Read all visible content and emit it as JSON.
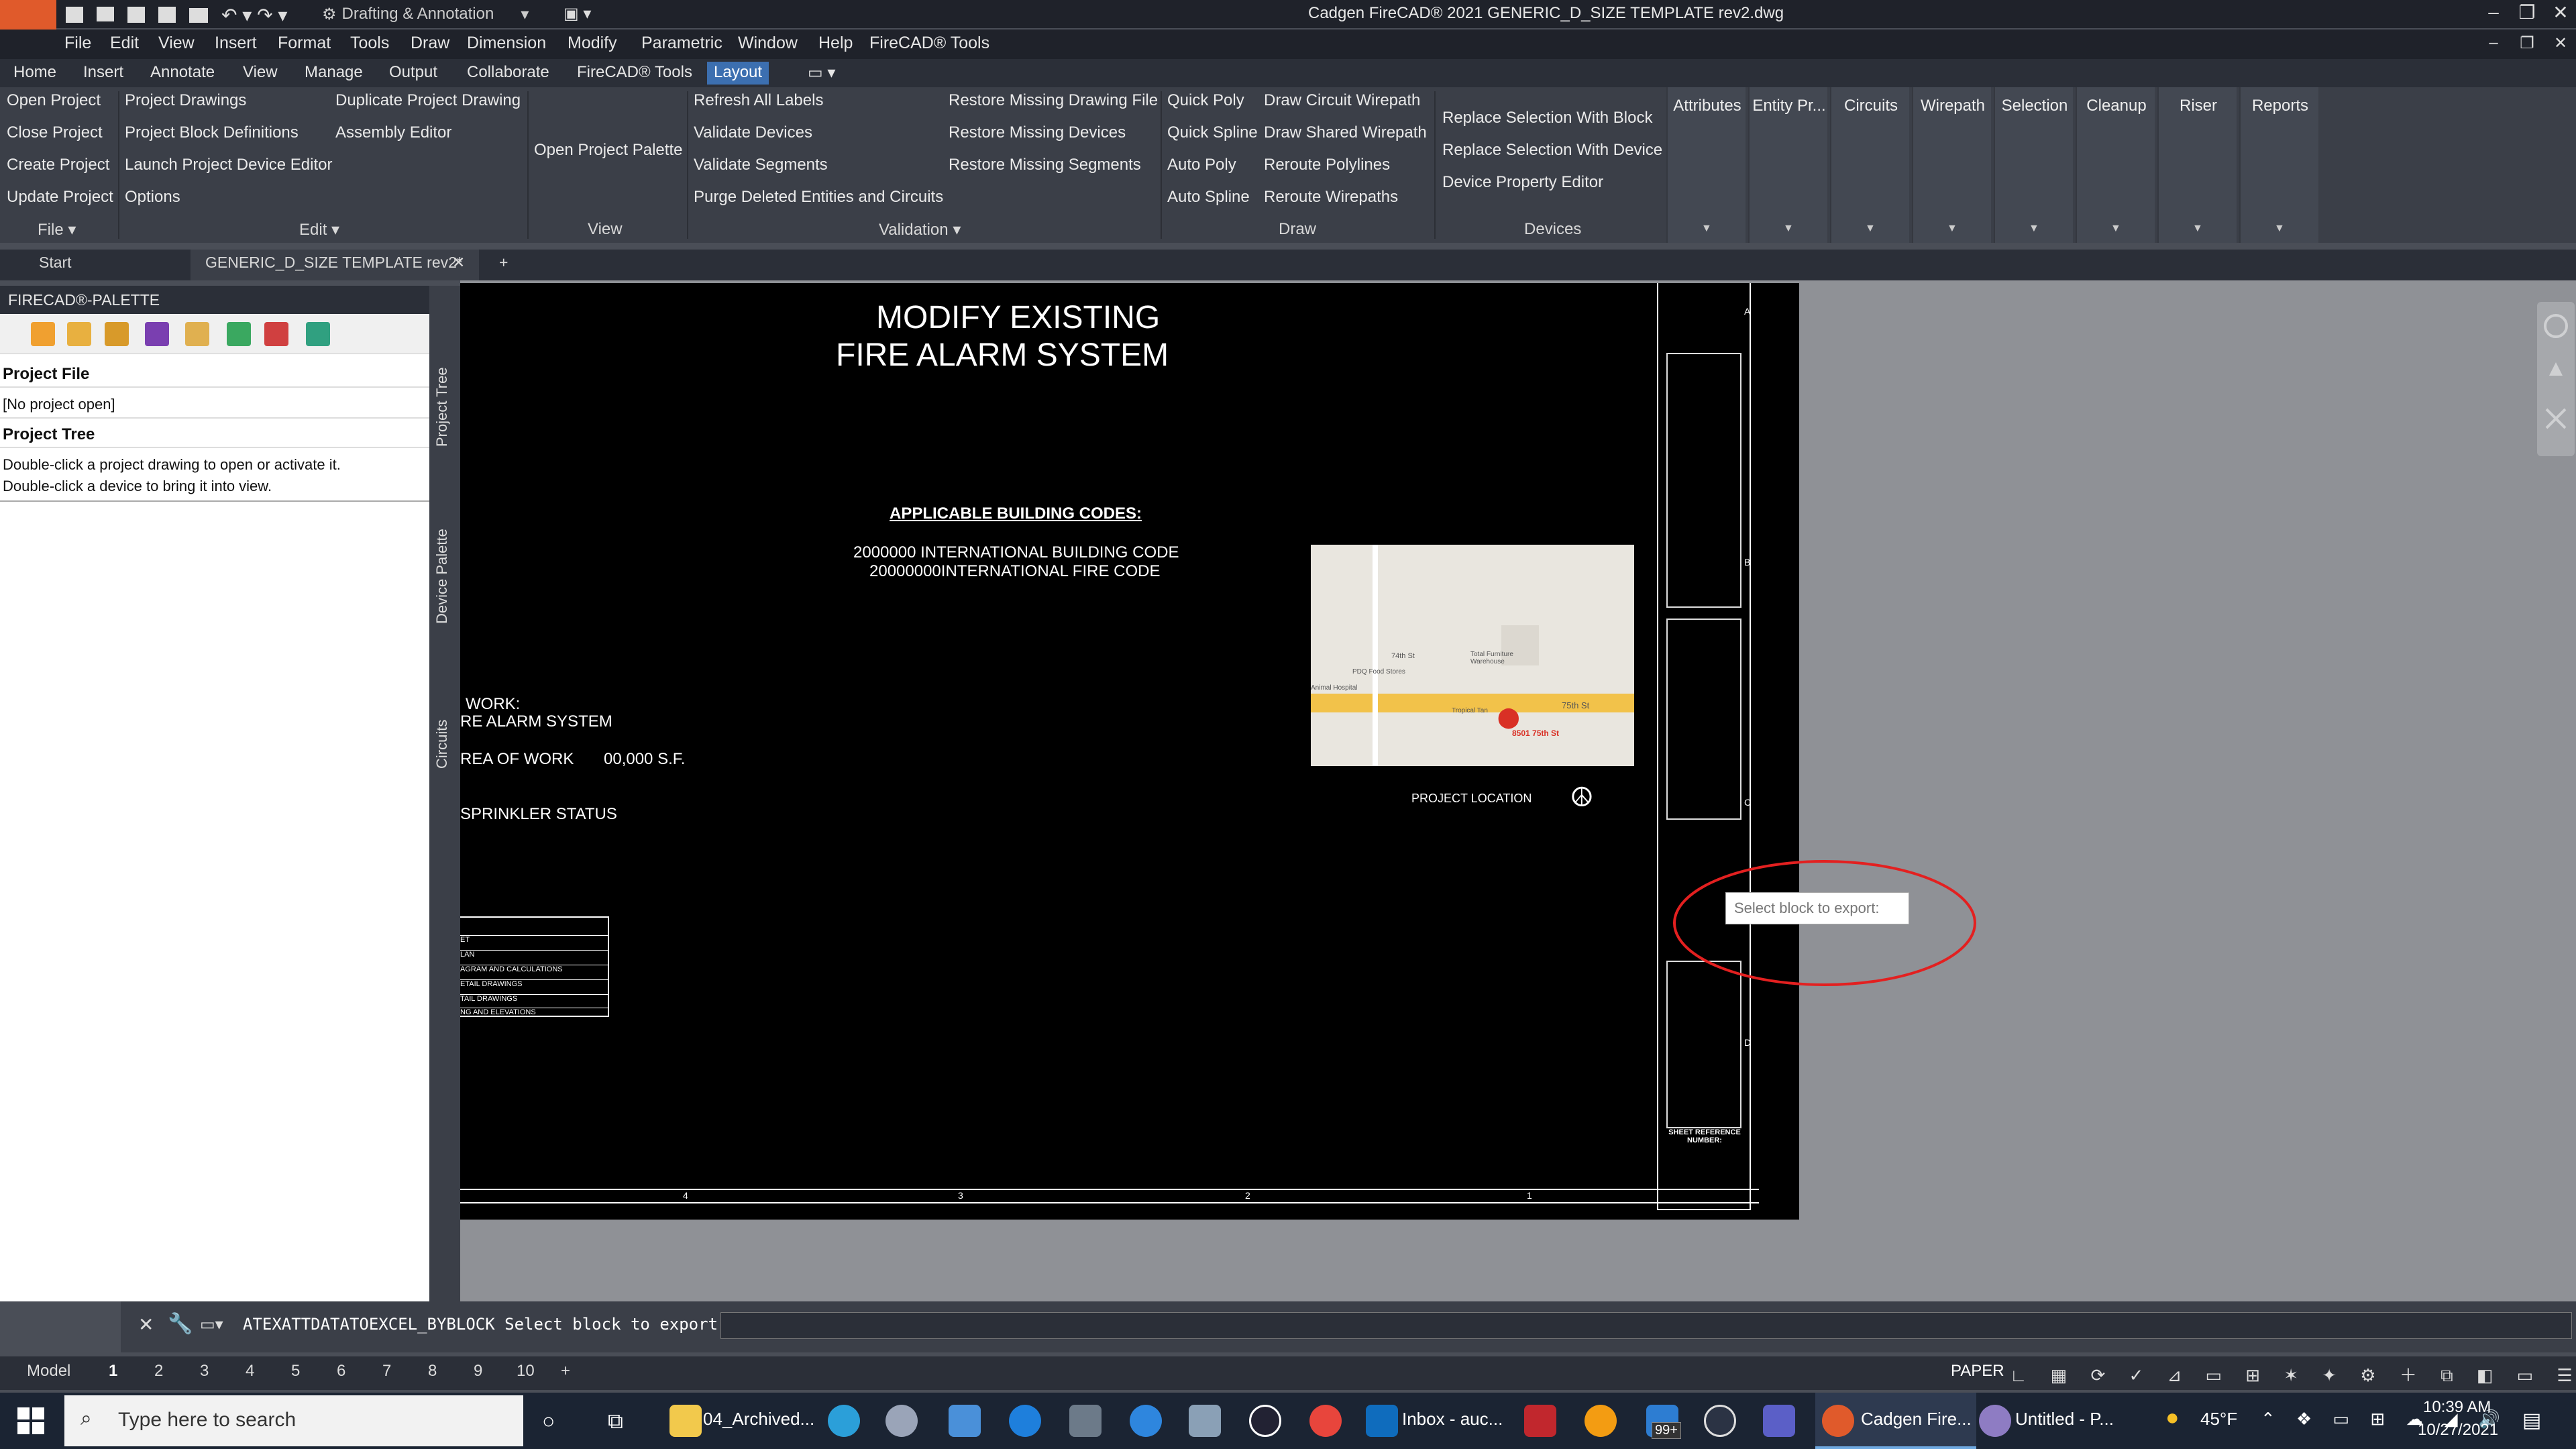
{
  "window": {
    "title": "Cadgen FireCAD® 2021    GENERIC_D_SIZE TEMPLATE rev2.dwg",
    "workspace": "Drafting & Annotation"
  },
  "menu": [
    "File",
    "Edit",
    "View",
    "Insert",
    "Format",
    "Tools",
    "Draw",
    "Dimension",
    "Modify",
    "Parametric",
    "Window",
    "Help",
    "FireCAD® Tools"
  ],
  "ribbon_tabs": [
    "Home",
    "Insert",
    "Annotate",
    "View",
    "Manage",
    "Output",
    "Collaborate",
    "FireCAD® Tools",
    "Layout"
  ],
  "ribbon": {
    "file": {
      "items": [
        "Open Project",
        "Close Project",
        "Create Project",
        "Update Project"
      ],
      "label": "File"
    },
    "edit": {
      "col1": [
        "Project Drawings",
        "Project Block Definitions",
        "Launch Project Device Editor",
        "Options"
      ],
      "col2": [
        "Duplicate Project Drawing",
        "Assembly Editor"
      ],
      "label": "Edit"
    },
    "view": {
      "items": [
        "Open Project Palette"
      ],
      "label": "View"
    },
    "validation": {
      "col1": [
        "Refresh All Labels",
        "Validate Devices",
        "Validate Segments",
        "Purge Deleted Entities and Circuits"
      ],
      "col2": [
        "Restore Missing Drawing File",
        "Restore Missing Devices",
        "Restore Missing Segments"
      ],
      "label": "Validation"
    },
    "draw": {
      "col1": [
        "Quick Poly",
        "Quick Spline",
        "Auto Poly",
        "Auto Spline"
      ],
      "col2": [
        "Draw Circuit Wirepath",
        "Draw Shared  Wirepath",
        "Reroute Polylines",
        "Reroute Wirepaths"
      ],
      "label": "Draw"
    },
    "devices": {
      "items": [
        "Replace Selection With Block",
        "Replace Selection With Device",
        "Device Property Editor"
      ],
      "label": "Devices"
    },
    "big_buttons": [
      "Attributes",
      "Entity Pr...",
      "Circuits",
      "Wirepath",
      "Selection",
      "Cleanup",
      "Riser",
      "Reports"
    ]
  },
  "doc_tabs": [
    "Start",
    "GENERIC_D_SIZE TEMPLATE rev2*"
  ],
  "palette": {
    "title": "FIRECAD®-PALETTE",
    "project_file_heading": "Project File",
    "project_file_value": "[No project open]",
    "project_tree_heading": "Project Tree",
    "hint1": "Double-click a project drawing to open or activate it.",
    "hint2": "Double-click a device to bring it into view.",
    "side_tabs": [
      "Project Tree",
      "Device Palette",
      "Circuits"
    ]
  },
  "drawing": {
    "title1": "MODIFY EXISTING",
    "title2": "FIRE ALARM SYSTEM",
    "codes_heading": "APPLICABLE BUILDING CODES:",
    "code1": "2000000 INTERNATIONAL BUILDING CODE",
    "code2": "20000000INTERNATIONAL FIRE CODE",
    "work1": "WORK:",
    "work2": "RE ALARM SYSTEM",
    "area": "REA OF WORK",
    "area_value": "00,000 S.F.",
    "sprinkler": "SPRINKLER STATUS",
    "index": [
      "ET",
      "LAN",
      "AGRAM AND CALCULATIONS",
      "ETAIL DRAWINGS",
      "TAIL DRAWINGS",
      "NG AND ELEVATIONS"
    ],
    "project_location": "PROJECT LOCATION",
    "map": {
      "st74": "74th St",
      "st75": "75th St",
      "pdq": "PDQ Food Stores",
      "furniture": "Total Furniture Warehouse",
      "hospital": "Animal Hospital",
      "tan": "Tropical Tan",
      "pin": "8501 75th St"
    },
    "sheet_ref": "SHEET REFERENCE NUMBER:",
    "grid_numbers": [
      "4",
      "3",
      "2",
      "1"
    ],
    "grid_letters": [
      "A",
      "B",
      "C",
      "D"
    ]
  },
  "tooltip": "Select block to export:",
  "command": {
    "text": "ATEXATTDATATOEXCEL_BYBLOCK Select block to export:",
    "value": ""
  },
  "layout_tabs": {
    "model": "Model",
    "pages": [
      "1",
      "2",
      "3",
      "4",
      "5",
      "6",
      "7",
      "8",
      "9",
      "10"
    ],
    "paper": "PAPER"
  },
  "taskbar": {
    "search_placeholder": "Type here to search",
    "apps": [
      "04_Archived...",
      "Inbox - auc...",
      "Cadgen Fire...",
      "Untitled - P..."
    ],
    "badge": "99+",
    "weather": "45°F",
    "time": "10:39 AM",
    "date": "10/27/2021"
  }
}
